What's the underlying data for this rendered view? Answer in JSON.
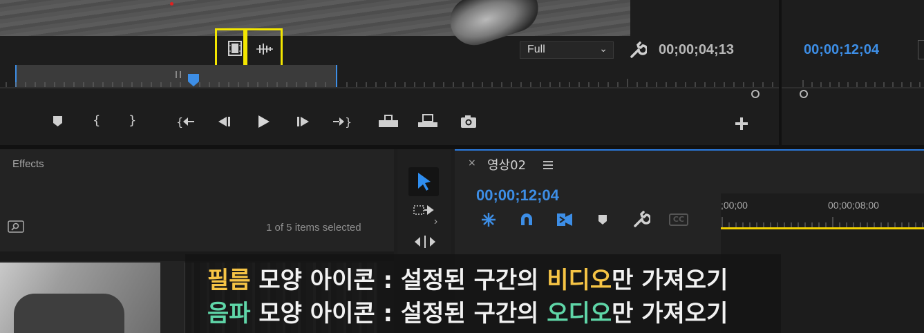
{
  "source_monitor": {
    "zoom_select": "Full",
    "playhead_timecode": "00;00;04;13",
    "highlight_color": "#f3e600",
    "drag_video_only_icon": "film-strip-icon",
    "drag_audio_only_icon": "waveform-icon",
    "transport_icons": [
      "add-marker-icon",
      "mark-in-icon",
      "mark-out-icon",
      "go-to-in-icon",
      "step-back-icon",
      "play-icon",
      "step-forward-icon",
      "go-to-out-icon",
      "insert-icon",
      "overwrite-icon",
      "export-frame-icon"
    ],
    "add_button_icon": "plus-icon"
  },
  "program_monitor": {
    "timecode": "00;00;12;04",
    "timecode_color": "#3d8ee6"
  },
  "effects_panel": {
    "title": "Effects",
    "items_selected": "1 of 5 items selected"
  },
  "timeline": {
    "close_label": "×",
    "sequence_name": "영상02",
    "menu_icon": "hamburger-menu-icon",
    "timecode": "00;00;12;04",
    "ruler_ticks": [
      ";00;00",
      "00;00;08;00"
    ],
    "tool_icons": [
      "nest-icon",
      "snap-magnet-icon",
      "linked-selection-icon",
      "add-marker-icon",
      "wrench-icon",
      "captions-icon"
    ],
    "captions_label": "CC",
    "work_area_color": "#f0d000"
  },
  "tools_panel": {
    "tools": [
      "selection-tool-icon",
      "track-select-icon",
      "ripple-edit-icon"
    ]
  },
  "caption": {
    "line1": {
      "highlight1": "필름",
      "middle": " 모양 아이콘 : 설정된 구간의 ",
      "highlight2": "비디오",
      "end": "만 가져오기",
      "color": "#f6c445"
    },
    "line2": {
      "highlight1": "음파",
      "middle": " 모양 아이콘 : 설정된 구간의 ",
      "highlight2": "오디오",
      "end": "만 가져오기",
      "color": "#5fd6a8"
    }
  }
}
